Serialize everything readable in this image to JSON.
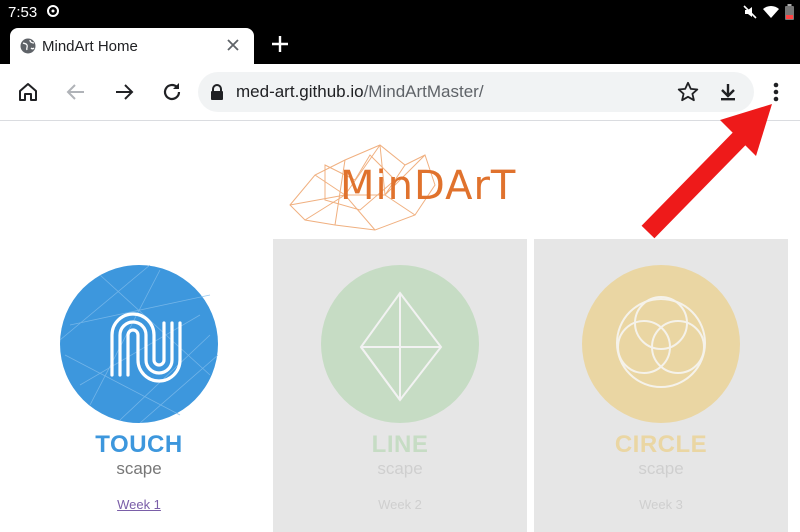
{
  "status_bar": {
    "time": "7:53",
    "icons": [
      "sync-icon",
      "mute-icon",
      "wifi-icon",
      "battery-icon"
    ]
  },
  "browser": {
    "tab": {
      "title": "MindArt Home"
    },
    "url_host": "med-art.github.io",
    "url_path": "/MindArtMaster/"
  },
  "page": {
    "logo_text": "MinDArT",
    "cards": [
      {
        "name": "TOUCH",
        "sub": "scape",
        "week": "Week 1",
        "color": "#3d97dd",
        "active": true
      },
      {
        "name": "LINE",
        "sub": "scape",
        "week": "Week 2",
        "color": "#c6dcc4",
        "active": false
      },
      {
        "name": "CIRCLE",
        "sub": "scape",
        "week": "Week 3",
        "color": "#ead6a3",
        "active": false
      }
    ]
  },
  "colors": {
    "accent_orange": "#e0722d",
    "annotation_arrow": "#ee1a1a"
  }
}
